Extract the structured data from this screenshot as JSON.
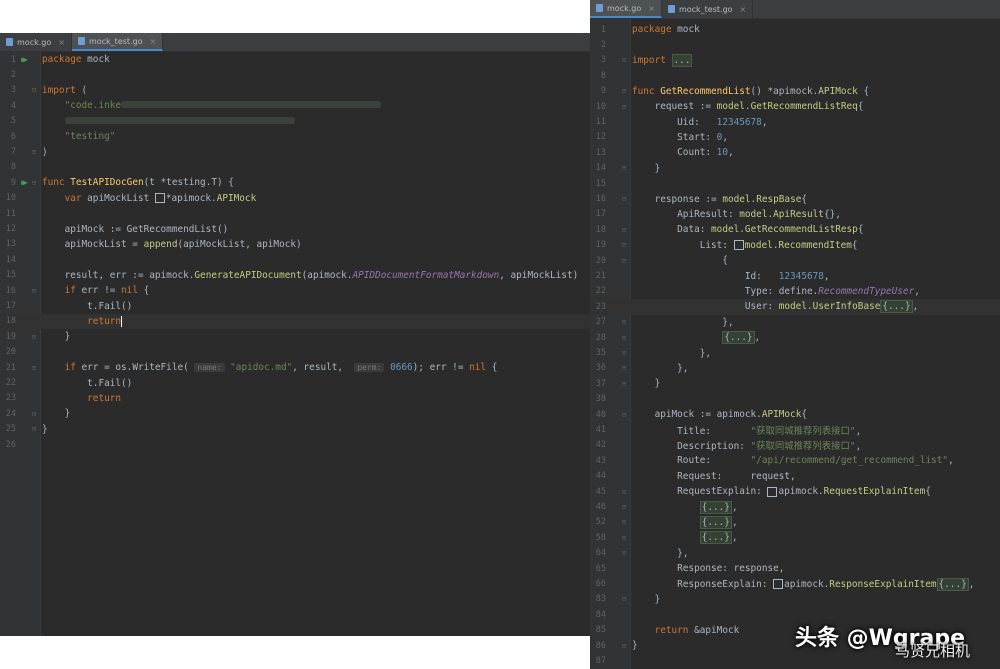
{
  "left": {
    "tabs": [
      {
        "label": "mock.go",
        "active": false
      },
      {
        "label": "mock_test.go",
        "active": true
      }
    ]
  },
  "right": {
    "tabs": [
      {
        "label": "mock.go",
        "active": true
      },
      {
        "label": "mock_test.go",
        "active": false
      }
    ]
  },
  "left_lines": [
    {
      "n": "1",
      "gutter": "run",
      "code": [
        [
          "k",
          "package"
        ],
        [
          "t",
          " mock"
        ]
      ]
    },
    {
      "n": "2",
      "code": []
    },
    {
      "n": "3",
      "fold": true,
      "code": [
        [
          "k",
          "import"
        ],
        [
          "t",
          " ("
        ]
      ]
    },
    {
      "n": "4",
      "code": [
        [
          "t",
          "    "
        ],
        [
          "s",
          "\"code.inke"
        ],
        [
          "blur",
          ""
        ]
      ]
    },
    {
      "n": "5",
      "code": [
        [
          "t",
          "    "
        ],
        [
          "blur",
          ""
        ]
      ]
    },
    {
      "n": "6",
      "code": [
        [
          "t",
          "    "
        ],
        [
          "s",
          "\"testing\""
        ]
      ]
    },
    {
      "n": "7",
      "fold": true,
      "code": [
        [
          "t",
          ")"
        ]
      ]
    },
    {
      "n": "8",
      "code": []
    },
    {
      "n": "9",
      "gutter": "run",
      "fold": true,
      "code": [
        [
          "k",
          "func"
        ],
        [
          "t",
          " "
        ],
        [
          "f",
          "TestAPIDocGen"
        ],
        [
          "t",
          "(t *testing.T) {"
        ]
      ]
    },
    {
      "n": "10",
      "code": [
        [
          "t",
          "    "
        ],
        [
          "k",
          "var"
        ],
        [
          "t",
          " apiMockList "
        ],
        [
          "sq",
          ""
        ],
        [
          "t",
          "*apimock."
        ],
        [
          "pkg",
          "APIMock"
        ]
      ]
    },
    {
      "n": "11",
      "code": []
    },
    {
      "n": "12",
      "code": [
        [
          "t",
          "    apiMock := GetRecommendList()"
        ]
      ]
    },
    {
      "n": "13",
      "code": [
        [
          "t",
          "    apiMockList = "
        ],
        [
          "pkg",
          "append"
        ],
        [
          "t",
          "(apiMockList, apiMock)"
        ]
      ]
    },
    {
      "n": "14",
      "code": []
    },
    {
      "n": "15",
      "code": [
        [
          "t",
          "    result, err := apimock."
        ],
        [
          "pkg",
          "GenerateAPIDocument"
        ],
        [
          "t",
          "(apimock."
        ],
        [
          "it",
          "APIDDocumentFormatMarkdown"
        ],
        [
          "t",
          ", apiMockList)"
        ]
      ]
    },
    {
      "n": "16",
      "fold": true,
      "code": [
        [
          "t",
          "    "
        ],
        [
          "k",
          "if"
        ],
        [
          "t",
          " err != "
        ],
        [
          "k",
          "nil"
        ],
        [
          "t",
          " {"
        ]
      ]
    },
    {
      "n": "17",
      "code": [
        [
          "t",
          "        t.Fail()"
        ]
      ]
    },
    {
      "n": "18",
      "current": true,
      "code": [
        [
          "t",
          "        "
        ],
        [
          "k",
          "return"
        ],
        [
          "cursor",
          ""
        ]
      ]
    },
    {
      "n": "19",
      "fold": true,
      "code": [
        [
          "t",
          "    }"
        ]
      ]
    },
    {
      "n": "20",
      "code": []
    },
    {
      "n": "21",
      "fold": true,
      "code": [
        [
          "t",
          "    "
        ],
        [
          "k",
          "if"
        ],
        [
          "t",
          " err = os.WriteFile( "
        ],
        [
          "hint",
          "name:"
        ],
        [
          "t",
          " "
        ],
        [
          "s",
          "\"apidoc.md\""
        ],
        [
          "t",
          ", result,  "
        ],
        [
          "hint",
          "perm:"
        ],
        [
          "t",
          " "
        ],
        [
          "n",
          "0666"
        ],
        [
          "t",
          "); err != "
        ],
        [
          "k",
          "nil"
        ],
        [
          "t",
          " {"
        ]
      ]
    },
    {
      "n": "22",
      "code": [
        [
          "t",
          "        t.Fail()"
        ]
      ]
    },
    {
      "n": "23",
      "code": [
        [
          "t",
          "        "
        ],
        [
          "k",
          "return"
        ]
      ]
    },
    {
      "n": "24",
      "fold": true,
      "code": [
        [
          "t",
          "    }"
        ]
      ]
    },
    {
      "n": "25",
      "fold": true,
      "code": [
        [
          "t",
          "}"
        ]
      ]
    },
    {
      "n": "26",
      "code": []
    }
  ],
  "right_lines": [
    {
      "n": "1",
      "code": [
        [
          "k",
          "package"
        ],
        [
          "t",
          " mock"
        ]
      ]
    },
    {
      "n": "2",
      "code": []
    },
    {
      "n": "3",
      "fold": true,
      "code": [
        [
          "k",
          "import"
        ],
        [
          "t",
          " "
        ],
        [
          "fb",
          "..."
        ]
      ]
    },
    {
      "n": "8",
      "code": []
    },
    {
      "n": "9",
      "fold": true,
      "code": [
        [
          "k",
          "func"
        ],
        [
          "t",
          " "
        ],
        [
          "f",
          "GetRecommendList"
        ],
        [
          "t",
          "() *apimock."
        ],
        [
          "pkg",
          "APIMock"
        ],
        [
          "t",
          " {"
        ]
      ]
    },
    {
      "n": "10",
      "fold": true,
      "code": [
        [
          "t",
          "    request := "
        ],
        [
          "pkg",
          "model"
        ],
        [
          "t",
          "."
        ],
        [
          "pkg",
          "GetRecommendListReq"
        ],
        [
          "t",
          "{"
        ]
      ]
    },
    {
      "n": "11",
      "code": [
        [
          "t",
          "        Uid:   "
        ],
        [
          "n",
          "12345678"
        ],
        [
          "t",
          ","
        ]
      ]
    },
    {
      "n": "12",
      "code": [
        [
          "t",
          "        Start: "
        ],
        [
          "n",
          "0"
        ],
        [
          "t",
          ","
        ]
      ]
    },
    {
      "n": "13",
      "code": [
        [
          "t",
          "        Count: "
        ],
        [
          "n",
          "10"
        ],
        [
          "t",
          ","
        ]
      ]
    },
    {
      "n": "14",
      "fold": true,
      "code": [
        [
          "t",
          "    }"
        ]
      ]
    },
    {
      "n": "15",
      "code": []
    },
    {
      "n": "16",
      "fold": true,
      "code": [
        [
          "t",
          "    response := "
        ],
        [
          "pkg",
          "model"
        ],
        [
          "t",
          "."
        ],
        [
          "pkg",
          "RespBase"
        ],
        [
          "t",
          "{"
        ]
      ]
    },
    {
      "n": "17",
      "code": [
        [
          "t",
          "        ApiResult: "
        ],
        [
          "pkg",
          "model"
        ],
        [
          "t",
          "."
        ],
        [
          "pkg",
          "ApiResult"
        ],
        [
          "t",
          "{},"
        ]
      ]
    },
    {
      "n": "18",
      "fold": true,
      "code": [
        [
          "t",
          "        Data: "
        ],
        [
          "pkg",
          "model"
        ],
        [
          "t",
          "."
        ],
        [
          "pkg",
          "GetRecommendListResp"
        ],
        [
          "t",
          "{"
        ]
      ]
    },
    {
      "n": "19",
      "fold": true,
      "code": [
        [
          "t",
          "            List: "
        ],
        [
          "sq",
          ""
        ],
        [
          "pkg",
          "model"
        ],
        [
          "t",
          "."
        ],
        [
          "pkg",
          "RecommendItem"
        ],
        [
          "t",
          "{"
        ]
      ]
    },
    {
      "n": "20",
      "fold": true,
      "code": [
        [
          "t",
          "                {"
        ]
      ]
    },
    {
      "n": "21",
      "code": [
        [
          "t",
          "                    Id:   "
        ],
        [
          "n",
          "12345678"
        ],
        [
          "t",
          ","
        ]
      ]
    },
    {
      "n": "22",
      "code": [
        [
          "t",
          "                    Type: define."
        ],
        [
          "it",
          "RecommendTypeUser"
        ],
        [
          "t",
          ","
        ]
      ]
    },
    {
      "n": "23",
      "current": true,
      "code": [
        [
          "t",
          "                    User: "
        ],
        [
          "pkg",
          "model"
        ],
        [
          "t",
          "."
        ],
        [
          "pkg",
          "UserInfoBase"
        ],
        [
          "fb",
          "{...}"
        ],
        [
          "t",
          ","
        ]
      ]
    },
    {
      "n": "27",
      "fold": true,
      "code": [
        [
          "t",
          "                },"
        ]
      ]
    },
    {
      "n": "28",
      "fold": true,
      "code": [
        [
          "t",
          "                "
        ],
        [
          "fb",
          "{...}"
        ],
        [
          "t",
          ","
        ]
      ]
    },
    {
      "n": "35",
      "fold": true,
      "code": [
        [
          "t",
          "            },"
        ]
      ]
    },
    {
      "n": "36",
      "fold": true,
      "code": [
        [
          "t",
          "        },"
        ]
      ]
    },
    {
      "n": "37",
      "fold": true,
      "code": [
        [
          "t",
          "    }"
        ]
      ]
    },
    {
      "n": "38",
      "code": []
    },
    {
      "n": "40",
      "fold": true,
      "code": [
        [
          "t",
          "    apiMock := apimock."
        ],
        [
          "pkg",
          "APIMock"
        ],
        [
          "t",
          "{"
        ]
      ]
    },
    {
      "n": "41",
      "code": [
        [
          "t",
          "        Title:       "
        ],
        [
          "s",
          "\"获取同城推荐列表接口\""
        ],
        [
          "t",
          ","
        ]
      ]
    },
    {
      "n": "42",
      "code": [
        [
          "t",
          "        Description: "
        ],
        [
          "s",
          "\"获取同城推荐列表接口\""
        ],
        [
          "t",
          ","
        ]
      ]
    },
    {
      "n": "43",
      "code": [
        [
          "t",
          "        Route:       "
        ],
        [
          "s",
          "\"/api/recommend/get_recommend_list\""
        ],
        [
          "t",
          ","
        ]
      ]
    },
    {
      "n": "44",
      "code": [
        [
          "t",
          "        Request:     request,"
        ]
      ]
    },
    {
      "n": "45",
      "fold": true,
      "code": [
        [
          "t",
          "        RequestExplain: "
        ],
        [
          "sq",
          ""
        ],
        [
          "t",
          "apimock."
        ],
        [
          "pkg",
          "RequestExplainItem"
        ],
        [
          "t",
          "{"
        ]
      ]
    },
    {
      "n": "46",
      "fold": true,
      "code": [
        [
          "t",
          "            "
        ],
        [
          "fb",
          "{...}"
        ],
        [
          "t",
          ","
        ]
      ]
    },
    {
      "n": "52",
      "fold": true,
      "code": [
        [
          "t",
          "            "
        ],
        [
          "fb",
          "{...}"
        ],
        [
          "t",
          ","
        ]
      ]
    },
    {
      "n": "58",
      "fold": true,
      "code": [
        [
          "t",
          "            "
        ],
        [
          "fb",
          "{...}"
        ],
        [
          "t",
          ","
        ]
      ]
    },
    {
      "n": "64",
      "fold": true,
      "code": [
        [
          "t",
          "        },"
        ]
      ]
    },
    {
      "n": "65",
      "code": [
        [
          "t",
          "        Response: response,"
        ]
      ]
    },
    {
      "n": "66",
      "code": [
        [
          "t",
          "        ResponseExplain: "
        ],
        [
          "sq",
          ""
        ],
        [
          "t",
          "apimock."
        ],
        [
          "pkg",
          "ResponseExplainItem"
        ],
        [
          "fb",
          "{...}"
        ],
        [
          "t",
          ","
        ]
      ]
    },
    {
      "n": "83",
      "fold": true,
      "code": [
        [
          "t",
          "    }"
        ]
      ]
    },
    {
      "n": "84",
      "code": []
    },
    {
      "n": "85",
      "code": [
        [
          "t",
          "    "
        ],
        [
          "k",
          "return"
        ],
        [
          "t",
          " &apiMock"
        ]
      ]
    },
    {
      "n": "86",
      "fold": true,
      "code": [
        [
          "t",
          "}"
        ]
      ]
    },
    {
      "n": "87",
      "code": []
    }
  ],
  "watermark": {
    "main": "头条 @Wgrape",
    "sub": "马贤兄相机"
  }
}
